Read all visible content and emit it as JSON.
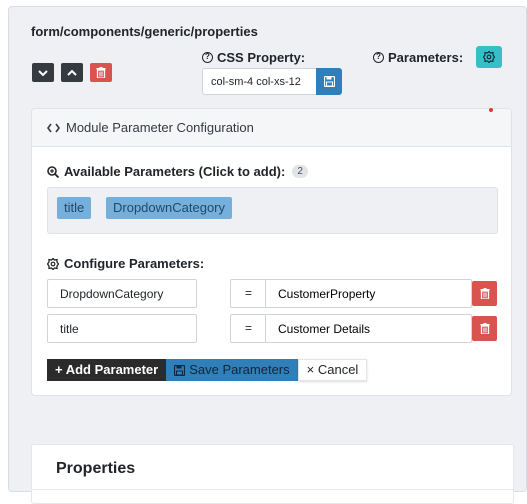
{
  "component_path": "form/components/generic/properties",
  "css_property": {
    "label": "CSS Property:",
    "value": "col-sm-4 col-xs-12"
  },
  "parameters_label": "Parameters:",
  "module": {
    "title": "Module Parameter Configuration",
    "available_label": "Available Parameters (Click to add):",
    "available_count": "2",
    "available": [
      "title",
      "DropdownCategory"
    ],
    "configure_label": "Configure Parameters:",
    "rows": [
      {
        "key": "DropdownCategory",
        "eq": "=",
        "value": "CustomerProperty"
      },
      {
        "key": "title",
        "eq": "=",
        "value": "Customer Details"
      }
    ],
    "add_label": "+ Add Parameter",
    "save_label": "Save Parameters",
    "cancel_label": "× Cancel"
  },
  "properties_title": "Properties",
  "colors": {
    "dark_button": "#343a40",
    "danger": "#d9534f",
    "primary": "#2f7fba",
    "info": "#36bfc6",
    "chip": "#74b0db"
  }
}
